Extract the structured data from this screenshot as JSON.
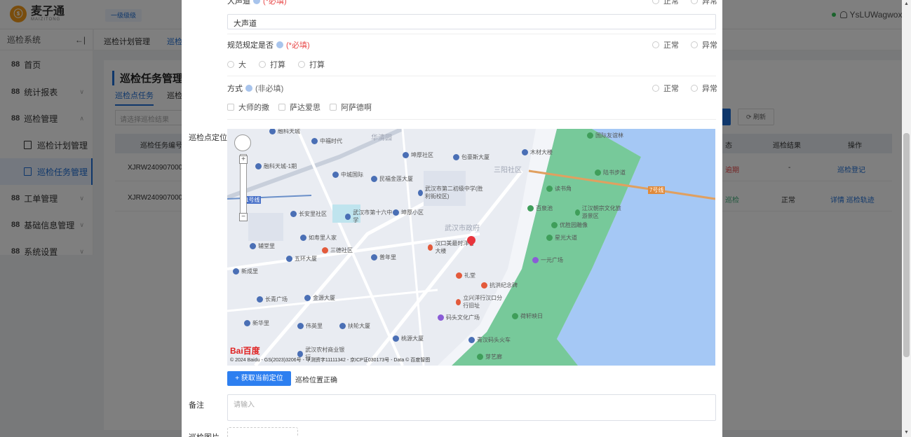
{
  "app": {
    "logo_mark": "ⓢ",
    "logo_cn": "麦子通",
    "logo_en": "MAIZITONG",
    "top_tag": "一级级级",
    "user_name": "YsLUWagwox"
  },
  "sidebar": {
    "title": "巡检系统",
    "collapse_icon": "←|",
    "items": [
      {
        "label": "首页"
      },
      {
        "label": "统计报表"
      },
      {
        "label": "巡检管理"
      },
      {
        "label": "巡检计划管理"
      },
      {
        "label": "巡检任务管理"
      },
      {
        "label": "工单管理"
      },
      {
        "label": "基础信息管理"
      },
      {
        "label": "系统设置"
      }
    ]
  },
  "tabs": {
    "plan": "巡检计划管理",
    "task": "巡检"
  },
  "page": {
    "title": "巡检任务管理",
    "subtab_active": "巡检点任务",
    "subtab_other": "巡检",
    "filter_placeholder": "请选择巡检结果",
    "refresh": "刷新",
    "table": {
      "headers": [
        "巡检任务编号",
        "态",
        "巡检结果",
        "操作"
      ],
      "rows": [
        {
          "id": "XJRW240907000",
          "status": "逾期",
          "result": "-",
          "action": "巡检登记"
        },
        {
          "id": "XJRW240907000",
          "status": "巡检",
          "result": "正常",
          "action": "详情 巡检轨迹"
        }
      ]
    }
  },
  "dialog": {
    "q1": {
      "label": "大声道",
      "hint": "?",
      "required": "(*必填)",
      "value": "大声道",
      "opt_normal": "正常",
      "opt_abnormal": "异常"
    },
    "q2": {
      "label": "规范规定是否",
      "required": "(*必填)",
      "opt_normal": "正常",
      "opt_abnormal": "异常",
      "choices": [
        "大",
        "打算",
        "打算"
      ]
    },
    "q3": {
      "label": "方式",
      "optional": "(非必填)",
      "opt_normal": "正常",
      "opt_abnormal": "异常",
      "checks": [
        "大师的撒",
        "萨达爱思",
        "阿萨德啊"
      ]
    },
    "location_label": "巡检点定位",
    "locate_btn": "+ 获取当前定位",
    "locate_status": "巡检位置正确",
    "remark_label": "备注",
    "remark_placeholder": "请输入",
    "photo_label": "巡检图片"
  },
  "map": {
    "areas": [
      "华清园",
      "三阳社区",
      "武汉市政府"
    ],
    "pois": [
      {
        "text": "融科天城",
        "type": "blue"
      },
      {
        "text": "中福时代",
        "type": "blue"
      },
      {
        "text": "坤厚社区",
        "type": "blue"
      },
      {
        "text": "包豪斯大厦",
        "type": "blue"
      },
      {
        "text": "木材大楼",
        "type": "blue"
      },
      {
        "text": "国际友谊林",
        "type": "green"
      },
      {
        "text": "融科天城-1期",
        "type": "blue"
      },
      {
        "text": "中城国际",
        "type": "blue"
      },
      {
        "text": "民福金莲大厦",
        "type": "blue"
      },
      {
        "text": "武汉市第二初级中学(胜利街校区)",
        "type": "blue"
      },
      {
        "text": "长安里社区",
        "type": "blue"
      },
      {
        "text": "武汉市第十六中学",
        "type": "blue"
      },
      {
        "text": "坤厚小区",
        "type": "blue"
      },
      {
        "text": "如寿里人家",
        "type": "blue"
      },
      {
        "text": "辅堂里",
        "type": "blue"
      },
      {
        "text": "三德社区",
        "type": "red"
      },
      {
        "text": "五环大厦",
        "type": "blue"
      },
      {
        "text": "普年里",
        "type": "blue"
      },
      {
        "text": "新成里",
        "type": "blue"
      },
      {
        "text": "汉口美最时洋行大楼",
        "type": "red"
      },
      {
        "text": "礼堂",
        "type": "red"
      },
      {
        "text": "抗洪纪念碑",
        "type": "red"
      },
      {
        "text": "立兴洋行汉口分行旧址",
        "type": "red"
      },
      {
        "text": "长青广场",
        "type": "blue"
      },
      {
        "text": "金源大厦",
        "type": "blue"
      },
      {
        "text": "新华里",
        "type": "blue"
      },
      {
        "text": "伟英里",
        "type": "blue"
      },
      {
        "text": "扶轮大厦",
        "type": "blue"
      },
      {
        "text": "桃源大厦",
        "type": "blue"
      },
      {
        "text": "码头文化广场",
        "type": "purple"
      },
      {
        "text": "荷轩映日",
        "type": "green"
      },
      {
        "text": "青汉码头火车",
        "type": "blue"
      },
      {
        "text": "武汉农村商业银行",
        "type": "blue"
      },
      {
        "text": "芽艺廊",
        "type": "green"
      },
      {
        "text": "陆书步道",
        "type": "green"
      },
      {
        "text": "读书角",
        "type": "green"
      },
      {
        "text": "百泉池",
        "type": "green"
      },
      {
        "text": "江汉朝宗文化旅游景区",
        "type": "green"
      },
      {
        "text": "优胜园雕像",
        "type": "green"
      },
      {
        "text": "星光大道",
        "type": "green"
      },
      {
        "text": "一元广场",
        "type": "purple"
      }
    ],
    "metro": [
      "1号线",
      "7号线"
    ],
    "logo": "Bai百度",
    "copyright": "© 2024 Baidu - GS(2023)3206号 - 甲测资字11111342 - 京ICP证030173号 - Data © 百度智图"
  },
  "colors": {
    "accent": "#1f6fd6",
    "required": "#e84a4a",
    "river": "#a5c8f5",
    "park": "#3fae7a"
  }
}
